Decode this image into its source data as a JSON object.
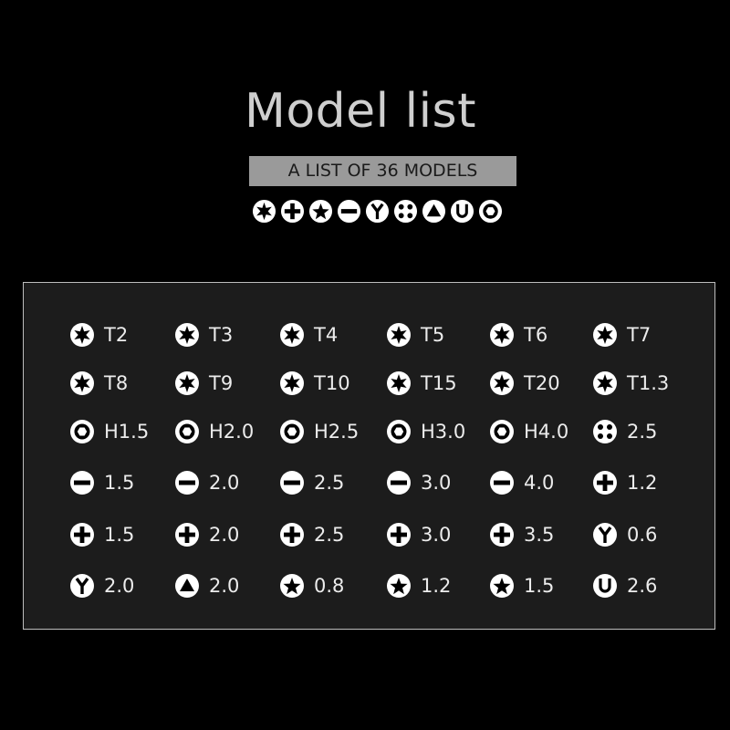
{
  "header": {
    "title": "Model list",
    "subtitle": "A LIST OF 36 MODELS",
    "icons": [
      "torx-icon",
      "phillips-icon",
      "pentalobe-icon",
      "slotted-icon",
      "tri-wing-icon",
      "quad-dot-icon",
      "triangle-icon",
      "u-shape-icon",
      "hex-icon"
    ]
  },
  "colors": {
    "background": "#000000",
    "panel": "#1c1c1c",
    "icon": "#ffffff",
    "badge": "#9a9a9a"
  },
  "models": [
    {
      "icon": "torx",
      "label": "T2"
    },
    {
      "icon": "torx",
      "label": "T3"
    },
    {
      "icon": "torx",
      "label": "T4"
    },
    {
      "icon": "torx",
      "label": "T5"
    },
    {
      "icon": "torx",
      "label": "T6"
    },
    {
      "icon": "torx",
      "label": "T7"
    },
    {
      "icon": "torx",
      "label": "T8"
    },
    {
      "icon": "torx",
      "label": "T9"
    },
    {
      "icon": "torx",
      "label": "T10"
    },
    {
      "icon": "torx",
      "label": "T15"
    },
    {
      "icon": "torx",
      "label": "T20"
    },
    {
      "icon": "torx",
      "label": "T1.3"
    },
    {
      "icon": "hex",
      "label": "H1.5"
    },
    {
      "icon": "hex",
      "label": "H2.0"
    },
    {
      "icon": "hex",
      "label": "H2.5"
    },
    {
      "icon": "hex",
      "label": "H3.0"
    },
    {
      "icon": "hex",
      "label": "H4.0"
    },
    {
      "icon": "quad-dot",
      "label": "2.5"
    },
    {
      "icon": "slotted",
      "label": "1.5"
    },
    {
      "icon": "slotted",
      "label": "2.0"
    },
    {
      "icon": "slotted",
      "label": "2.5"
    },
    {
      "icon": "slotted",
      "label": "3.0"
    },
    {
      "icon": "slotted",
      "label": "4.0"
    },
    {
      "icon": "phillips",
      "label": "1.2"
    },
    {
      "icon": "phillips",
      "label": "1.5"
    },
    {
      "icon": "phillips",
      "label": "2.0"
    },
    {
      "icon": "phillips",
      "label": "2.5"
    },
    {
      "icon": "phillips",
      "label": "3.0"
    },
    {
      "icon": "phillips",
      "label": "3.5"
    },
    {
      "icon": "tri-wing",
      "label": "0.6"
    },
    {
      "icon": "tri-wing",
      "label": "2.0"
    },
    {
      "icon": "triangle",
      "label": "2.0"
    },
    {
      "icon": "pentalobe",
      "label": "0.8"
    },
    {
      "icon": "pentalobe",
      "label": "1.2"
    },
    {
      "icon": "pentalobe",
      "label": "1.5"
    },
    {
      "icon": "u-shape",
      "label": "2.6"
    }
  ]
}
